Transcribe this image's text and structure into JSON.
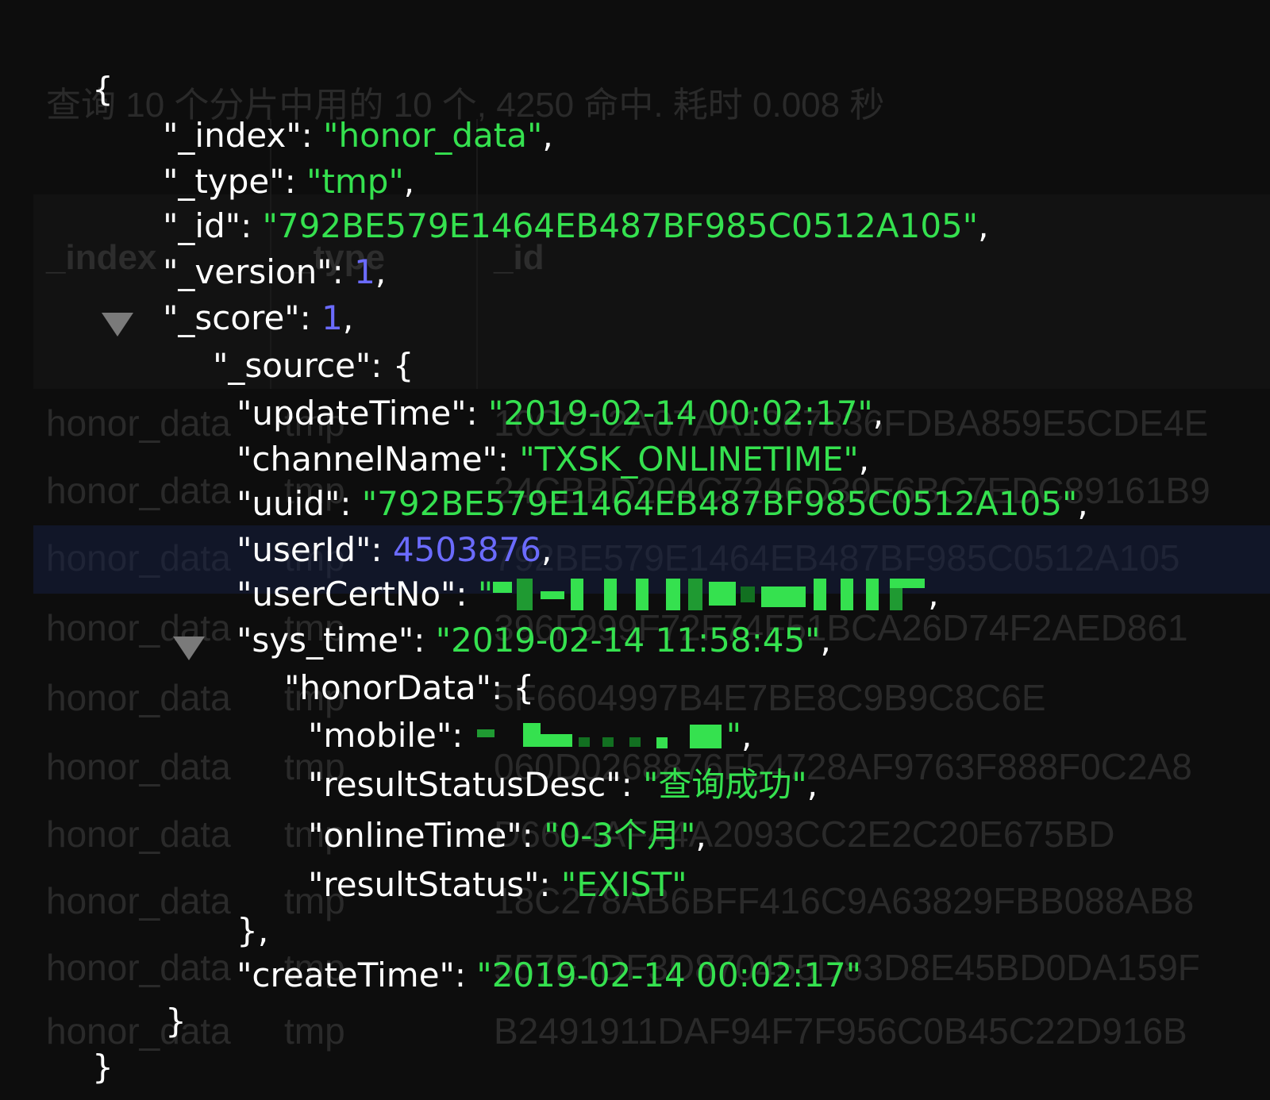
{
  "background": {
    "summary": "查询 10 个分片中用的 10 个, 4250 命中. 耗时 0.008 秒",
    "columns": [
      "_index",
      "_type",
      "_id"
    ],
    "rows": [
      {
        "index": "honor_data",
        "type": "tmp",
        "id": "10CC12A07AA1367836FDBA859E5CDE4E"
      },
      {
        "index": "honor_data",
        "type": "tmp",
        "id": "24CBBD204C7246D39E6BC7EDC89161B9"
      },
      {
        "index": "honor_data",
        "type": "tmp",
        "id": "792BE579E1464EB487BF985C0512A105"
      },
      {
        "index": "honor_data",
        "type": "tmp",
        "id": "396F999F72F74F51BCA26D74F2AED861"
      },
      {
        "index": "honor_data",
        "type": "tmp",
        "id": "5F6604997B4E7BE8C9B9C8C6E"
      },
      {
        "index": "honor_data",
        "type": "tmp",
        "id": "060D0268876F54728AF9763F888F0C2A8"
      },
      {
        "index": "honor_data",
        "type": "tmp",
        "id": "D6694AF44A2093CC2E2C20E675BD"
      },
      {
        "index": "honor_data",
        "type": "tmp",
        "id": "18C278AB6BFF416C9A63829FBB088AB8"
      },
      {
        "index": "honor_data",
        "type": "tmp",
        "id": "557E1DF3D870455D83D8E45BD0DA159F"
      },
      {
        "index": "honor_data",
        "type": "tmp",
        "id": "B2491911DAF94F7F956C0B45C22D916B"
      }
    ]
  },
  "json": {
    "open_brace": "{",
    "close_brace": "}",
    "index_key": "\"_index\"",
    "index_val": "\"honor_data\"",
    "type_key": "\"_type\"",
    "type_val": "\"tmp\"",
    "id_key": "\"_id\"",
    "id_val": "\"792BE579E1464EB487BF985C0512A105\"",
    "version_key": "\"_version\"",
    "version_val": "1",
    "score_key": "\"_score\"",
    "score_val": "1",
    "source_key": "\"_source\"",
    "source": {
      "updateTime_key": "\"updateTime\"",
      "updateTime_val": "\"2019-02-14 00:02:17\"",
      "channelName_key": "\"channelName\"",
      "channelName_val": "\"TXSK_ONLINETIME\"",
      "uuid_key": "\"uuid\"",
      "uuid_val": "\"792BE579E1464EB487BF985C0512A105\"",
      "userId_key": "\"userId\"",
      "userId_val": "4503876",
      "userCertNo_key": "\"userCertNo\"",
      "userCertNo_open_quote": "\"",
      "sys_time_key": "\"sys_time\"",
      "sys_time_val": "\"2019-02-14 11:58:45\"",
      "honorData_key": "\"honorData\"",
      "honorData": {
        "mobile_key": "\"mobile\"",
        "mobile_close_quote": "\"",
        "resultStatusDesc_key": "\"resultStatusDesc\"",
        "resultStatusDesc_val": "\"查询成功\"",
        "onlineTime_key": "\"onlineTime\"",
        "onlineTime_val": "\"0-3个月\"",
        "resultStatus_key": "\"resultStatus\"",
        "resultStatus_val": "\"EXIST\""
      },
      "honorData_close": "},",
      "createTime_key": "\"createTime\"",
      "createTime_val": "\"2019-02-14 00:02:17\""
    },
    "source_close": "}"
  },
  "colors": {
    "key": "#ffffff",
    "string": "#35e14f",
    "number": "#6b6bff",
    "background": "#0d0d0d",
    "caret": "#7a7a7a"
  },
  "icons": {
    "source_toggle": "caret-down-icon",
    "honorData_toggle": "caret-down-icon"
  }
}
